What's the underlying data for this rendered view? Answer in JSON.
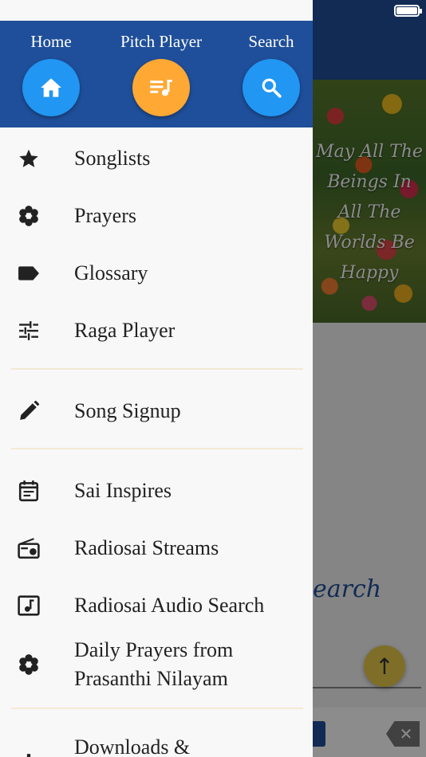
{
  "background": {
    "banner_text": "May All The Beings In All The Worlds Be Happy",
    "search_word": "earch"
  },
  "header": {
    "buttons": [
      {
        "label": "Home",
        "icon": "home-icon",
        "color": "#2196f3"
      },
      {
        "label": "Pitch Player",
        "icon": "queue-music-icon",
        "color": "#ffa834"
      },
      {
        "label": "Search",
        "icon": "search-icon",
        "color": "#2196f3"
      }
    ]
  },
  "menu": {
    "items": [
      {
        "label": "Songlists",
        "icon": "star-icon"
      },
      {
        "label": "Prayers",
        "icon": "flower-icon"
      },
      {
        "label": "Glossary",
        "icon": "label-tag-icon"
      },
      {
        "label": "Raga Player",
        "icon": "tune-sliders-icon"
      },
      {
        "label": "Song Signup",
        "icon": "pencil-icon"
      },
      {
        "label": "Sai Inspires",
        "icon": "calendar-note-icon"
      },
      {
        "label": "Radiosai Streams",
        "icon": "radio-icon"
      },
      {
        "label": "Radiosai Audio Search",
        "icon": "music-note-box-icon"
      },
      {
        "label": "Daily Prayers from Prasanthi Nilayam",
        "icon": "flower-icon"
      },
      {
        "label": "Downloads &",
        "icon": "download-icon"
      }
    ]
  },
  "colors": {
    "header_bg": "#1f4f9a",
    "drawer_bg": "#f8f8f8",
    "accent_blue": "#2196f3",
    "accent_orange": "#ffa834"
  }
}
